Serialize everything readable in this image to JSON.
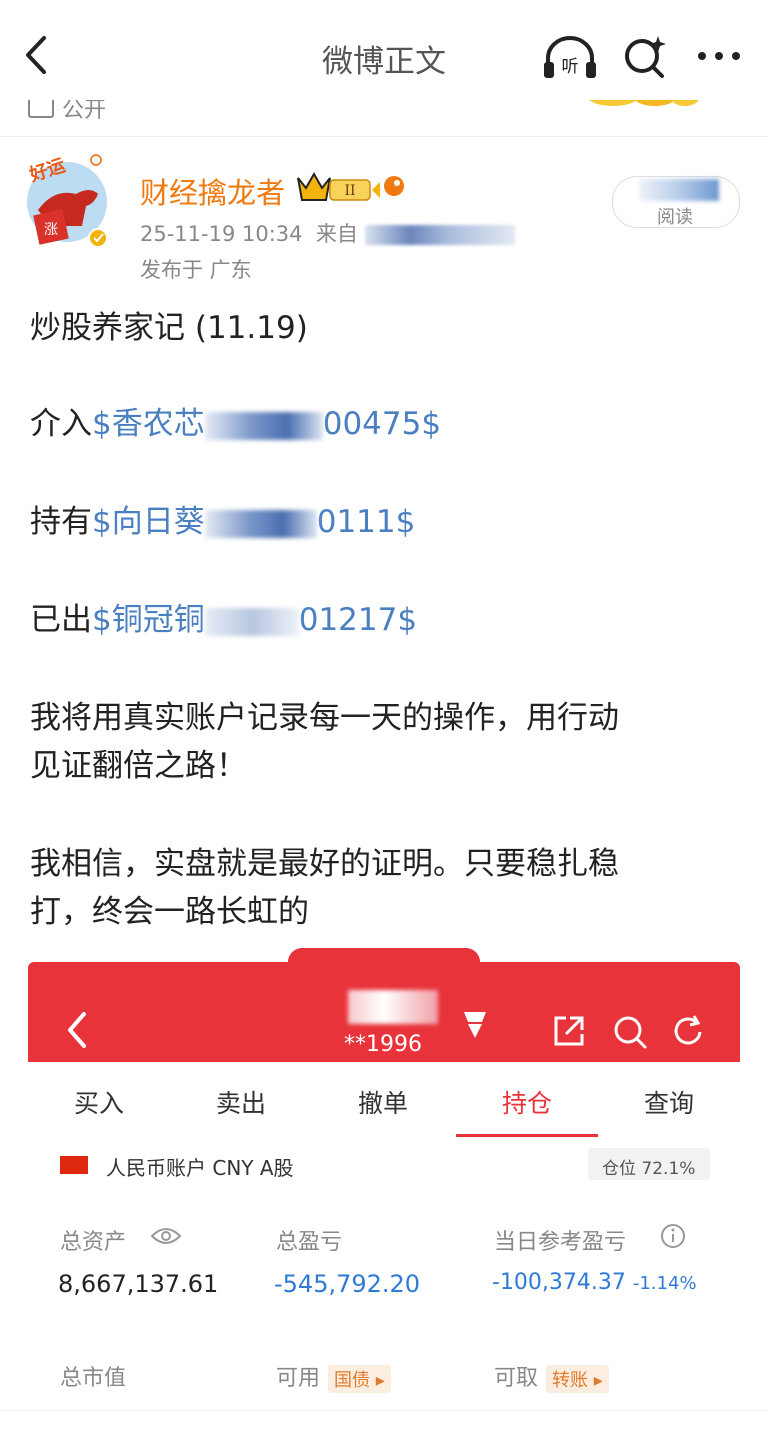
{
  "nav": {
    "title": "微博正文",
    "listen_label": "听"
  },
  "subbar": {
    "visibility_label": "公开"
  },
  "post": {
    "author": "财经擒龙者",
    "badge_level": "II",
    "timestamp": "25-11-19 10:34",
    "source_prefix": "来自",
    "location": "发布于 广东",
    "read_label": "阅读",
    "avatar_badges": {
      "top": "好运",
      "bottom": "涨"
    },
    "lines": {
      "title": "炒股养家记 (11.19)",
      "line1_prefix": "介入",
      "line1_tag_a": "$香农芯",
      "line1_tag_b": "00475$",
      "line2_prefix": "持有",
      "line2_tag_a": "$向日葵",
      "line2_tag_b": "0111$",
      "line3_prefix": "已出",
      "line3_tag_a": "$铜冠铜",
      "line3_tag_b": "01217$",
      "para1_a": "我将用真实账户记录每一天的操作，用行动",
      "para1_b": "见证翻倍之路！",
      "para2_a": "我相信，实盘就是最好的证明。只要稳扎稳",
      "para2_b": "打，终会一路长虹的"
    }
  },
  "broker": {
    "account_suffix": "**1996",
    "tabs": [
      "买入",
      "卖出",
      "撤单",
      "持仓",
      "查询"
    ],
    "active_tab": "持仓",
    "account_label": "人民币账户 CNY A股",
    "position_label": "仓位 72.1%",
    "total_assets_label": "总资产",
    "total_assets": "8,667,137.61",
    "total_pnl_label": "总盈亏",
    "total_pnl": "-545,792.20",
    "day_pnl_label": "当日参考盈亏",
    "day_pnl": "-100,374.37",
    "day_pnl_pct": "-1.14%",
    "market_value_label": "总市值",
    "available_label": "可用",
    "available_tag": "国债",
    "withdrawable_label": "可取",
    "withdrawable_tag": "转账"
  },
  "colors": {
    "brand_orange": "#f07a10",
    "link_blue": "#4a7fc1",
    "broker_red": "#e8333a",
    "loss_blue": "#2f7ad6"
  }
}
